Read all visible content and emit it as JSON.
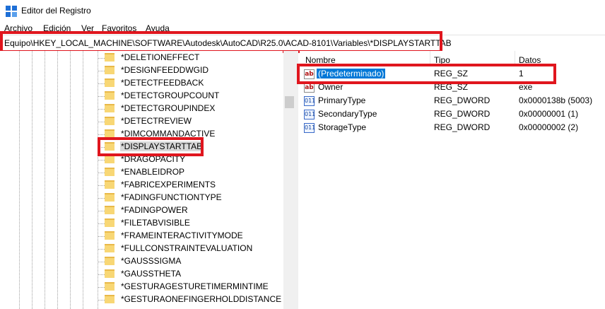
{
  "window": {
    "title": "Editor del Registro"
  },
  "menu": [
    "Archivo",
    "Edición",
    "Ver",
    "Favoritos",
    "Ayuda"
  ],
  "address": {
    "path": "Equipo\\HKEY_LOCAL_MACHINE\\SOFTWARE\\Autodesk\\AutoCAD\\R25.0\\ACAD-8101\\Variables\\*DISPLAYSTARTTAB"
  },
  "tree": {
    "items": [
      "*DELETIONEFFECT",
      "*DESIGNFEEDDWGID",
      "*DETECTFEEDBACK",
      "*DETECTGROUPCOUNT",
      "*DETECTGROUPINDEX",
      "*DETECTREVIEW",
      "*DIMCOMMANDACTIVE",
      "*DISPLAYSTARTTAB",
      "*DRAGOPACITY",
      "*ENABLEIDROP",
      "*FABRICEXPERIMENTS",
      "*FADINGFUNCTIONTYPE",
      "*FADINGPOWER",
      "*FILETABVISIBLE",
      "*FRAMEINTERACTIVITYMODE",
      "*FULLCONSTRAINTEVALUATION",
      "*GAUSSSIGMA",
      "*GAUSSTHETA",
      "*GESTURAGESTURETIMERMINTIME",
      "*GESTURAONEFINGERHOLDDISTANCE"
    ],
    "selected_index": 7
  },
  "list": {
    "columns": {
      "name": "Nombre",
      "type": "Tipo",
      "data": "Datos"
    },
    "rows": [
      {
        "name": "(Predeterminado)",
        "type": "REG_SZ",
        "data": "1",
        "icon": "string-value-icon",
        "selected": true
      },
      {
        "name": "Owner",
        "type": "REG_SZ",
        "data": "exe",
        "icon": "string-value-icon"
      },
      {
        "name": "PrimaryType",
        "type": "REG_DWORD",
        "data": "0x0000138b (5003)",
        "icon": "binary-value-icon"
      },
      {
        "name": "SecondaryType",
        "type": "REG_DWORD",
        "data": "0x00000001 (1)",
        "icon": "binary-value-icon"
      },
      {
        "name": "StorageType",
        "type": "REG_DWORD",
        "data": "0x00000002 (2)",
        "icon": "binary-value-icon"
      }
    ]
  },
  "icons": {
    "string_glyph": "ab",
    "binary_glyph": "011"
  },
  "colors": {
    "highlight_box": "#e0161e",
    "selection": "#0078d7",
    "folder": "#f8d775"
  }
}
